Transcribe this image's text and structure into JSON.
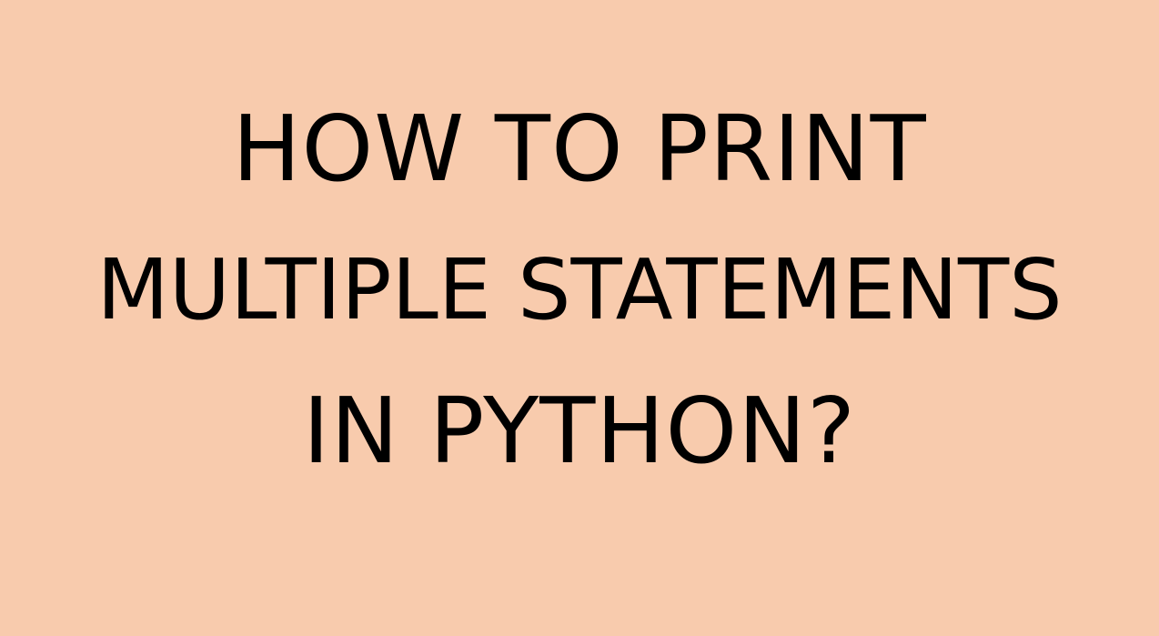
{
  "colors": {
    "background": "#f8cbad",
    "text": "#000000"
  },
  "title_lines": [
    "HOW TO PRINT",
    "MULTIPLE STATEMENTS",
    "IN PYTHON?"
  ]
}
